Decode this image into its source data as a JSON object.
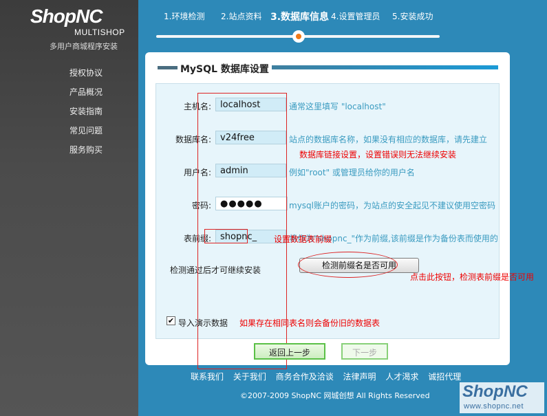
{
  "brand": {
    "logo": "ShopNC",
    "logo_sub": "MULTISHOP",
    "tagline": "多用户商城程序安装"
  },
  "sidebar": {
    "items": [
      {
        "label": "授权协议"
      },
      {
        "label": "产品概况"
      },
      {
        "label": "安装指南"
      },
      {
        "label": "常见问题"
      },
      {
        "label": "服务购买"
      }
    ]
  },
  "steps": [
    {
      "label": "1.环境检测"
    },
    {
      "label": "2.站点资料"
    },
    {
      "label": "3.数据库信息",
      "active": true
    },
    {
      "label": "4.设置管理员"
    },
    {
      "label": "5.安装成功"
    }
  ],
  "panel": {
    "title": "MySQL 数据库设置",
    "fields": {
      "host": {
        "label": "主机名:",
        "value": "localhost",
        "hint": "通常这里填写 \"localhost\""
      },
      "dbname": {
        "label": "数据库名:",
        "value": "v24free",
        "hint": "站点的数据库名称，如果没有相应的数据库，请先建立"
      },
      "user": {
        "label": "用户名:",
        "value": "admin",
        "hint": "例如\"root\" 或管理员给你的用户名"
      },
      "password": {
        "label": "密码:",
        "value": "●●●●●",
        "hint": "mysql账户的密码，为站点的安全起见不建议使用空密码"
      },
      "prefix": {
        "label": "表前缀:",
        "value": "shopnc_",
        "hint": "将作为\"shopnc_\"作为前缀,该前缀是作为备份表而使用的"
      }
    },
    "check_note": "检测通过后才可继续安装",
    "check_button": "检测前缀名是否可用",
    "import_label": "导入演示数据",
    "import_note": "如果存在相同表名则会备份旧的数据表"
  },
  "annotations": {
    "db_note": "数据库链接设置，设置错误则无法继续安装",
    "prefix_note": "设置数据表前缀",
    "button_note": "点击此按钮，检测表前缀是否可用"
  },
  "buttons": {
    "prev": "返回上一步",
    "next": "下一步"
  },
  "footer": {
    "links": [
      "联系我们",
      "关于我们",
      "商务合作及洽谈",
      "法律声明",
      "人才渴求",
      "诚招代理"
    ],
    "copyright": "©2007-2009 ShopNC 网城创想  All Rights Reserved"
  },
  "watermark": {
    "brand": "ShopNC",
    "url": "www.shopnc.net"
  },
  "colors": {
    "background": "#2d89b8",
    "sidebar": "#444444",
    "accent": "#f07a18",
    "hint": "#3a9bc0",
    "annotation": "#ee0000"
  }
}
